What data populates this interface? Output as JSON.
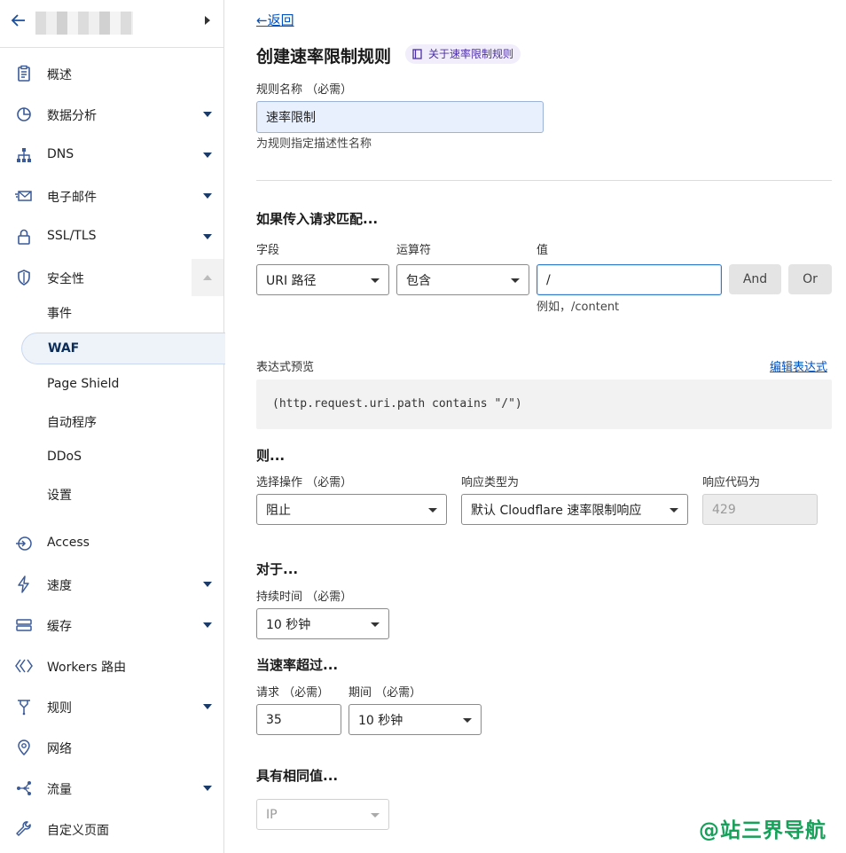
{
  "colors": {
    "link": "#0051c3",
    "accent_icon": "#3a5a9a",
    "watermark": "#17a05a"
  },
  "sidebar": {
    "items": [
      {
        "label": "概述",
        "icon": "clipboard-icon",
        "caret": false
      },
      {
        "label": "数据分析",
        "icon": "pie-chart-icon",
        "caret": true
      },
      {
        "label": "DNS",
        "icon": "network-icon",
        "caret": true
      },
      {
        "label": "电子邮件",
        "icon": "envelope-icon",
        "caret": true
      },
      {
        "label": "SSL/TLS",
        "icon": "lock-icon",
        "caret": true
      },
      {
        "label": "安全性",
        "icon": "shield-icon",
        "caret": "up"
      }
    ],
    "security_sub": [
      {
        "label": "事件"
      },
      {
        "label": "WAF",
        "active": true
      },
      {
        "label": "Page Shield"
      },
      {
        "label": "自动程序"
      },
      {
        "label": "DDoS"
      },
      {
        "label": "设置"
      }
    ],
    "items_bottom": [
      {
        "label": "Access",
        "icon": "access-icon",
        "caret": false
      },
      {
        "label": "速度",
        "icon": "lightning-icon",
        "caret": true
      },
      {
        "label": "缓存",
        "icon": "storage-icon",
        "caret": true
      },
      {
        "label": "Workers 路由",
        "icon": "workers-icon",
        "caret": false
      },
      {
        "label": "规则",
        "icon": "rules-icon",
        "caret": true
      },
      {
        "label": "网络",
        "icon": "location-icon",
        "caret": false
      },
      {
        "label": "流量",
        "icon": "traffic-icon",
        "caret": true
      },
      {
        "label": "自定义页面",
        "icon": "wrench-icon",
        "caret": false
      }
    ]
  },
  "main": {
    "back": "←返回",
    "title": "创建速率限制规则",
    "docs_pill": "关于速率限制规则",
    "rule_name": {
      "label": "规则名称 （必需）",
      "value": "速率限制",
      "hint": "为规则指定描述性名称"
    },
    "match": {
      "heading": "如果传入请求匹配...",
      "field_label": "字段",
      "field_value": "URI 路径",
      "operator_label": "运算符",
      "operator_value": "包含",
      "value_label": "值",
      "value_value": "/",
      "value_hint": "例如，/content",
      "and_label": "And",
      "or_label": "Or"
    },
    "expression": {
      "label": "表达式预览",
      "edit_link": "编辑表达式",
      "code": "(http.request.uri.path contains \"/\")"
    },
    "then": {
      "heading": "则...",
      "action_label": "选择操作 （必需）",
      "action_value": "阻止",
      "response_type_label": "响应类型为",
      "response_type_value": "默认 Cloudflare 速率限制响应",
      "response_code_label": "响应代码为",
      "response_code_value": "429"
    },
    "for": {
      "heading": "对于...",
      "duration_label": "持续时间 （必需）",
      "duration_value": "10 秒钟"
    },
    "rate": {
      "heading": "当速率超过...",
      "requests_label": "请求 （必需）",
      "requests_value": "35",
      "period_label": "期间 （必需）",
      "period_value": "10 秒钟"
    },
    "same": {
      "heading": "具有相同值...",
      "value": "IP"
    }
  },
  "watermark": "@站三界导航"
}
